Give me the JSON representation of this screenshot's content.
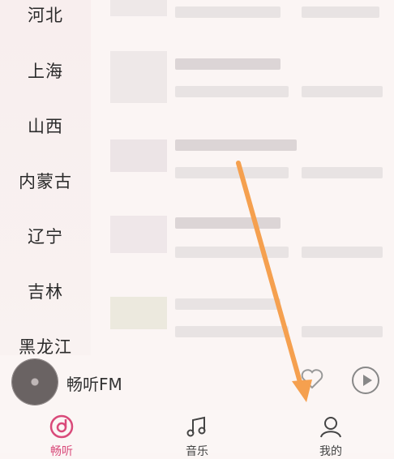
{
  "regions": [
    "河北",
    "上海",
    "山西",
    "内蒙古",
    "辽宁",
    "吉林",
    "黑龙江"
  ],
  "mini_player": {
    "title": "畅听FM"
  },
  "tabs": [
    {
      "label": "畅听",
      "icon": "radio-icon",
      "active": true
    },
    {
      "label": "音乐",
      "icon": "music-note-icon",
      "active": false
    },
    {
      "label": "我的",
      "icon": "user-icon",
      "active": false
    }
  ],
  "colors": {
    "accent": "#d94a7a",
    "annotation_arrow": "#f5a04f"
  }
}
